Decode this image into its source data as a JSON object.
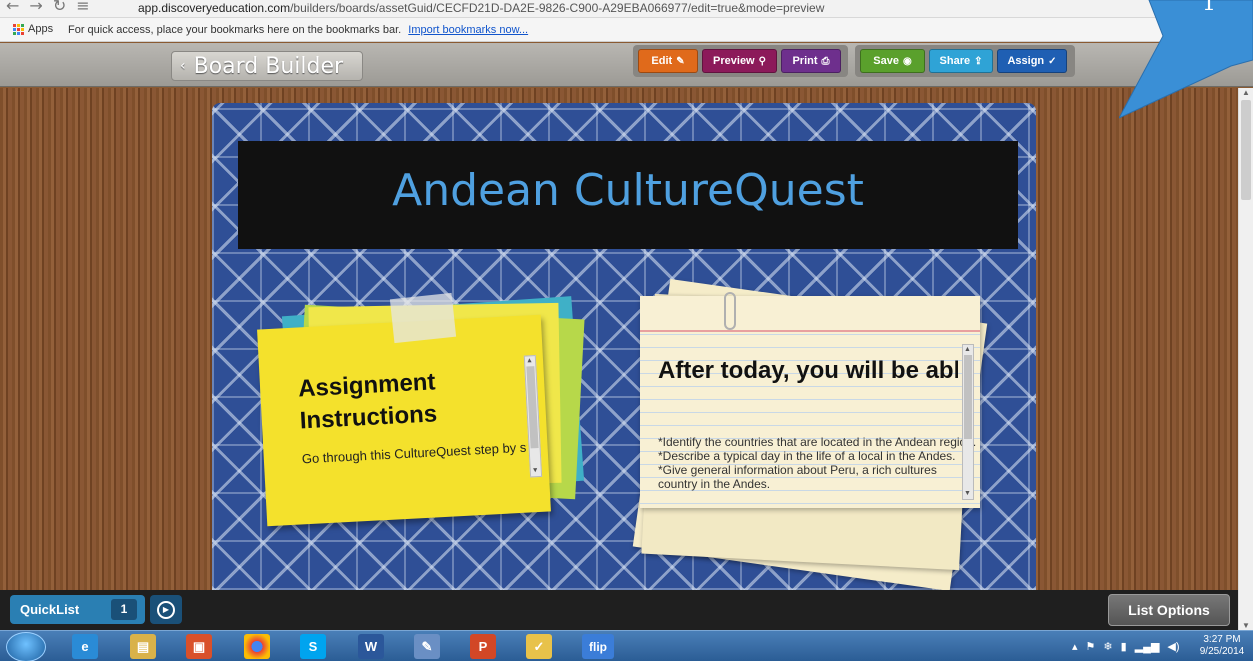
{
  "browser": {
    "url_domain": "app.discoveryeducation.com",
    "url_path": "/builders/boards/assetGuid/CECFD21D-DA2E-9826-C900-A29EBA066977/edit=true&mode=preview",
    "bookmarks_apps_label": "Apps",
    "bookmarks_hint": "For quick access, place your bookmarks here on the bookmarks bar.",
    "bookmarks_import_link": "Import bookmarks now..."
  },
  "header": {
    "back_label": "Board Builder",
    "buttons": {
      "edit": "Edit",
      "preview": "Preview",
      "print": "Print",
      "save": "Save",
      "share": "Share",
      "assign": "Assign"
    },
    "colors": {
      "edit": "#e06a1b",
      "preview": "#8c1a5a",
      "print": "#6e2f8d",
      "save": "#5aa02c",
      "share": "#2fa3d6",
      "assign": "#1f5fb3"
    }
  },
  "board": {
    "title": "Andean CultureQuest",
    "sticky": {
      "heading": "Assignment Instructions",
      "body": "Go through this CultureQuest step by step, following all directions"
    },
    "card": {
      "heading": "After today, you will be able to...",
      "body": "*Identify the countries that are located in the Andean region. *Describe a typical day in the life of a local in the Andes. *Give general information about Peru, a rich cultures country in the Andes."
    }
  },
  "bottombar": {
    "quicklist_label": "QuickList",
    "quicklist_count": "1",
    "list_options_label": "List Options"
  },
  "taskbar": {
    "time": "3:27 PM",
    "date": "9/25/2014",
    "flip_label": "flip"
  },
  "callout": {
    "label": "1"
  }
}
